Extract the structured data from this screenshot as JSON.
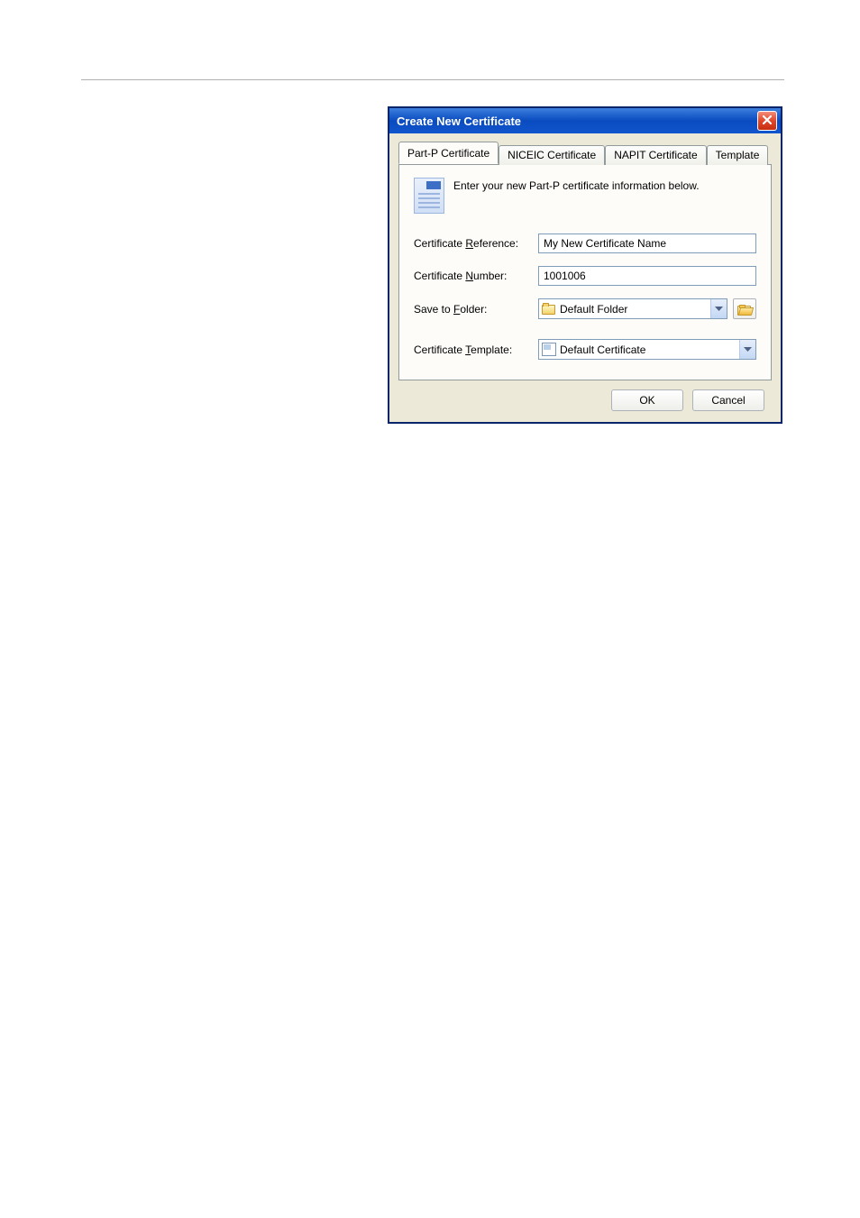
{
  "dialog": {
    "title": "Create New Certificate",
    "tabs": [
      {
        "label": "Part-P Certificate"
      },
      {
        "label": "NICEIC Certificate"
      },
      {
        "label": "NAPIT Certificate"
      },
      {
        "label": "Template"
      }
    ],
    "intro": "Enter your new Part-P certificate information below.",
    "fields": {
      "ref_label_pre": "Certificate ",
      "ref_label_u": "R",
      "ref_label_post": "eference:",
      "ref_value": "My New Certificate Name",
      "num_label_pre": "Certificate ",
      "num_label_u": "N",
      "num_label_post": "umber:",
      "num_value": "1001006",
      "folder_label_pre": "Save to ",
      "folder_label_u": "F",
      "folder_label_post": "older:",
      "folder_value": "Default Folder",
      "tmpl_label_pre": "Certificate ",
      "tmpl_label_u": "T",
      "tmpl_label_post": "emplate:",
      "tmpl_value": "Default Certificate"
    },
    "buttons": {
      "ok": "OK",
      "cancel": "Cancel"
    }
  }
}
